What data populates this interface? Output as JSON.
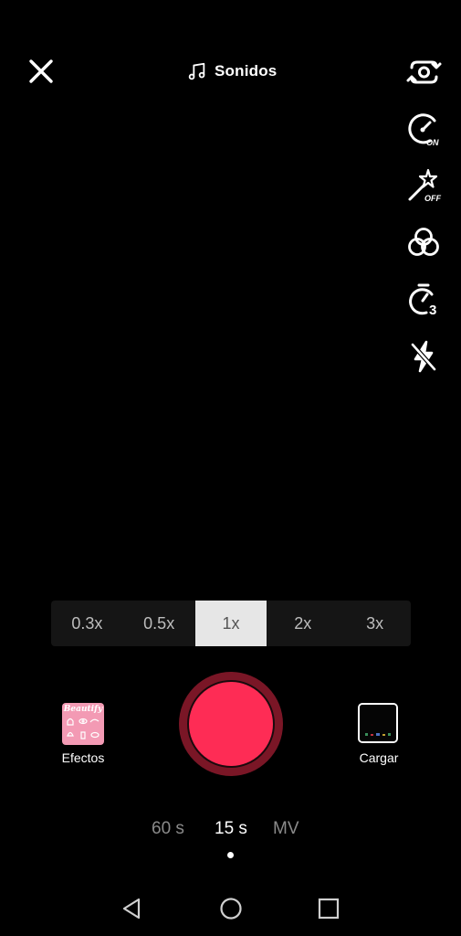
{
  "top_bar": {
    "sounds_label": "Sonidos"
  },
  "tools": [
    {
      "name": "flip-camera",
      "icon": "flip-camera-icon"
    },
    {
      "name": "speed",
      "icon": "speed-icon",
      "badge": "ON"
    },
    {
      "name": "beautify",
      "icon": "magic-wand-icon",
      "badge": "OFF"
    },
    {
      "name": "filters",
      "icon": "filters-icon"
    },
    {
      "name": "timer",
      "icon": "timer-icon",
      "badge": "3"
    },
    {
      "name": "flash",
      "icon": "flash-off-icon"
    }
  ],
  "speed": {
    "options": [
      "0.3x",
      "0.5x",
      "1x",
      "2x",
      "3x"
    ],
    "selected": "1x"
  },
  "effects": {
    "label": "Efectos",
    "thumb_text": "Beautify"
  },
  "upload": {
    "label": "Cargar"
  },
  "durations": {
    "options": [
      "60 s",
      "15 s",
      "MV"
    ],
    "selected": "15 s"
  },
  "colors": {
    "record": "#fe2c55",
    "record_ring": "#7a1626",
    "background": "#000000"
  }
}
